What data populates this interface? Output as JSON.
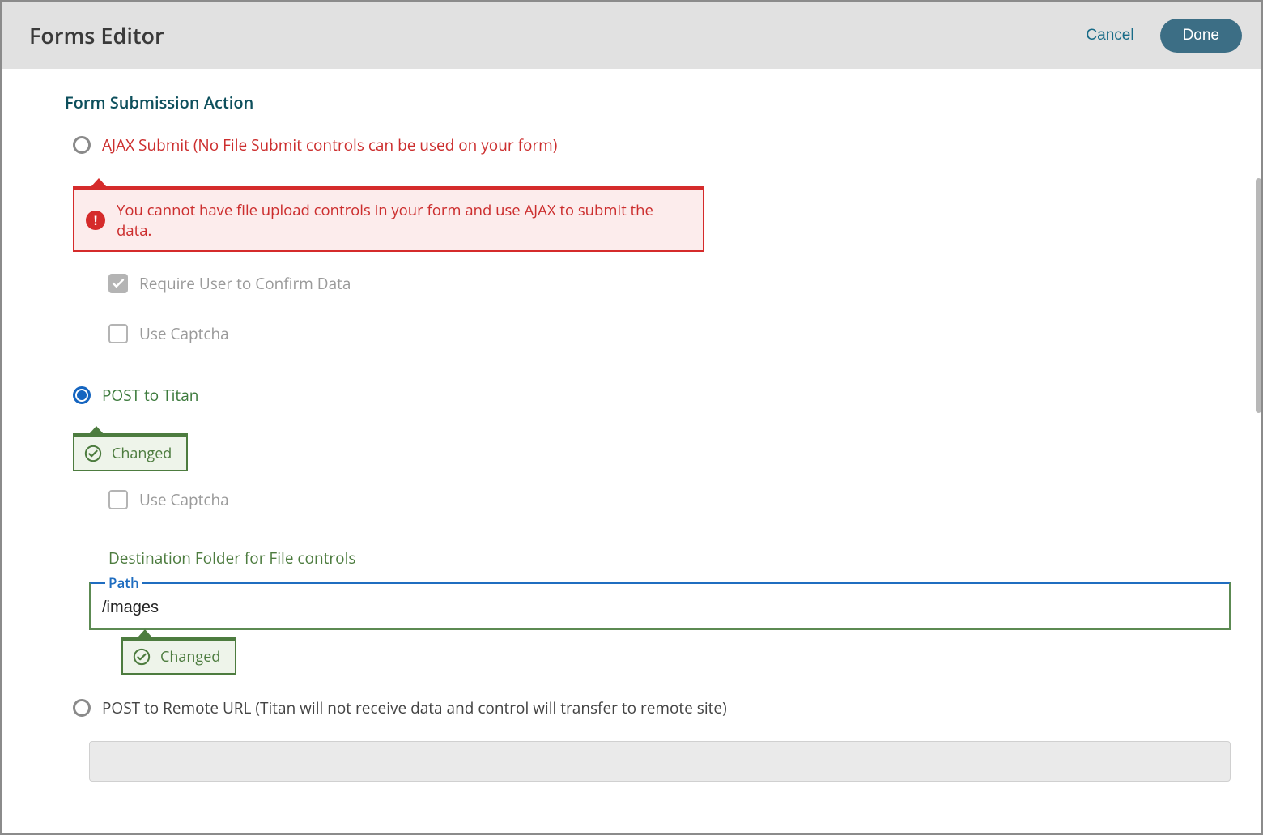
{
  "header": {
    "title": "Forms Editor",
    "cancel": "Cancel",
    "done": "Done"
  },
  "section": {
    "title": "Form Submission Action"
  },
  "ajax": {
    "label": "AJAX Submit (No File Submit controls can be used on your form)",
    "error": "You cannot have file upload controls in your form and use AJAX to submit the data.",
    "require_confirm_label": "Require User to Confirm Data",
    "use_captcha_label": "Use Captcha"
  },
  "titan": {
    "label": "POST to Titan",
    "changed_label": "Changed",
    "use_captcha_label": "Use Captcha",
    "dest_label": "Destination Folder for File controls",
    "path_legend": "Path",
    "path_value": "/images",
    "path_changed_label": "Changed"
  },
  "remote": {
    "label": "POST to Remote URL (Titan will not receive data and control will transfer to remote site)"
  }
}
